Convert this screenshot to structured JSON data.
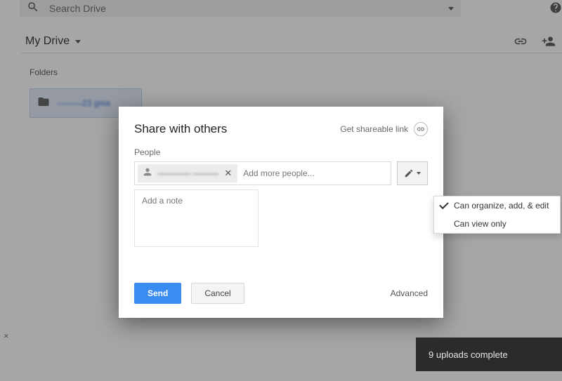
{
  "search": {
    "placeholder": "Search Drive"
  },
  "location": {
    "label": "My Drive"
  },
  "folders": {
    "heading": "Folders",
    "item_label": "———23 gma"
  },
  "modal": {
    "title": "Share with others",
    "shareable_link": "Get shareable link",
    "people_label": "People",
    "chip_name": "———— ———",
    "add_placeholder": "Add more people...",
    "note_placeholder": "Add a note",
    "send": "Send",
    "cancel": "Cancel",
    "advanced": "Advanced"
  },
  "perm_menu": {
    "option1": "Can organize, add, & edit",
    "option2": "Can view only"
  },
  "toast": {
    "text": "9 uploads complete"
  }
}
